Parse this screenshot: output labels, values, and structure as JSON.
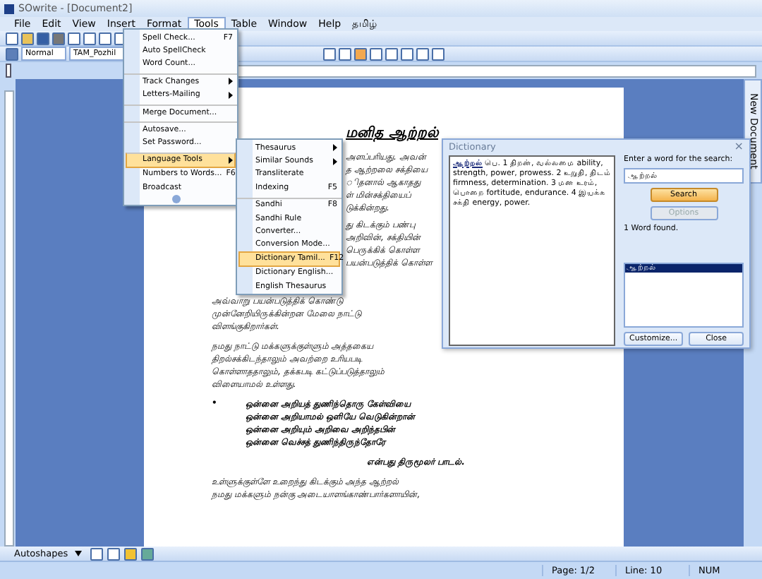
{
  "window": {
    "title": "SOwrite - [Document2]"
  },
  "menu_bar": [
    {
      "label": "File",
      "selected": false
    },
    {
      "label": "Edit",
      "selected": false
    },
    {
      "label": "View",
      "selected": false
    },
    {
      "label": "Insert",
      "selected": false
    },
    {
      "label": "Format",
      "selected": false
    },
    {
      "label": "Tools",
      "selected": true
    },
    {
      "label": "Table",
      "selected": false
    },
    {
      "label": "Window",
      "selected": false
    },
    {
      "label": "Help",
      "selected": false
    },
    {
      "label": "தமிழ்",
      "selected": false
    }
  ],
  "format_toolbar": {
    "style": "Normal",
    "font": "TAM_Pozhil"
  },
  "tools_menu": [
    {
      "label": "Spell Check...",
      "shortcut": "F7",
      "selected": false
    },
    {
      "label": "Auto SpellCheck",
      "selected": false
    },
    {
      "label": "Word Count...",
      "selected": false
    },
    {
      "label": "Track Changes",
      "submenu": true,
      "selected": false,
      "separator_before": true
    },
    {
      "label": "Letters-Mailing",
      "submenu": true,
      "selected": false
    },
    {
      "label": "Merge Document...",
      "selected": false,
      "separator_before": true
    },
    {
      "label": "Autosave...",
      "selected": false,
      "separator_before": true
    },
    {
      "label": "Set Password...",
      "selected": false
    },
    {
      "label": "Language Tools",
      "submenu": true,
      "selected": true,
      "separator_before": true
    },
    {
      "label": "Numbers to Words...",
      "shortcut": "F6",
      "selected": false
    },
    {
      "label": "Broadcast",
      "selected": false
    }
  ],
  "language_submenu": [
    {
      "label": "Thesaurus",
      "submenu": true,
      "selected": false
    },
    {
      "label": "Similar Sounds",
      "submenu": true,
      "selected": false
    },
    {
      "label": "Transliterate",
      "selected": false
    },
    {
      "label": "Indexing",
      "shortcut": "F5",
      "selected": false
    },
    {
      "label": "Sandhi",
      "shortcut": "F8",
      "selected": false,
      "separator_before": true
    },
    {
      "label": "Sandhi Rule",
      "selected": false
    },
    {
      "label": "Converter...",
      "selected": false
    },
    {
      "label": "Conversion Mode...",
      "selected": false
    },
    {
      "label": "Dictionary Tamil...",
      "shortcut": "F12",
      "selected": true
    },
    {
      "label": "Dictionary English...",
      "selected": false
    },
    {
      "label": "English Thesaurus",
      "selected": false
    }
  ],
  "document": [
    {
      "kind": "title",
      "lines": [
        "மனித ஆற்றல்"
      ]
    },
    {
      "kind": "partial",
      "lines": [
        "அளப்பரியது. அவன்",
        "த ஆற்றலை சக்தியை",
        "ிதனால் ஆகாதது",
        "ள் மின்சக்தியைப்",
        "டுக்கின்றது."
      ]
    },
    {
      "kind": "partial",
      "lines": [
        "து கிடக்கும் பண்பு",
        "அறிவின், சக்தியின்",
        "பெருக்கிக் கொள்ள",
        "பயன்படுத்திக் கொள்ள"
      ]
    },
    {
      "kind": "para",
      "lines": [
        "அவ்வாறு பயன்படுத்திக் கொண்டு",
        "முன்னேறியிருக்கின்றன மேலை நாட்டு",
        "விளங்குகிறார்கள்."
      ]
    },
    {
      "kind": "para",
      "lines": [
        "நமது நாட்டு மக்களுக்குள்ளும் அத்தகைய",
        "திறல்சக்கிடந்தாலும் அவற்றை உரியபடி",
        "கொள்ளாததாலும், தக்கபடி கட்டுப்படுத்தாலும்",
        "விளையாமல் உள்ளது."
      ]
    },
    {
      "kind": "poem",
      "marker": "•",
      "lines": [
        "ஒன்னை அறியத் துணிந்தொரு கேள்வியை",
        "ஒன்னை அறியாமல் ஒளியே வெடுகின்றான்",
        "ஒன்னை அறியும் அறிவை அறிந்தபின்",
        "ஒன்னை வெச்சத் துணிந்திருந்தோரே"
      ]
    },
    {
      "kind": "signature",
      "lines": [
        "என்பது திருமூலர் பாடல்."
      ]
    },
    {
      "kind": "para",
      "lines": [
        "உள்ளுக்குள்ளே உறைந்து கிடக்கும் அந்த ஆற்றல்",
        "நமது மக்களும் நன்கு அடையாளங்காண்பார்களாயின்,"
      ]
    }
  ],
  "dictionary": {
    "title": "Dictionary",
    "close": "×",
    "headword": "ஆற்றல்",
    "meaning": "பெ. 1 திறன், வல்லமை ability, strength, power, prowess. 2 உறுதி, திடம் firmness, determination. 3 மன உரம், பொறை fortitude, endurance. 4 இயக்க சக்தி energy, power.",
    "prompt": "Enter a word for the search:",
    "search_value": "ஆற்றல்",
    "search_button": "Search",
    "options_button": {
      "label": "Options",
      "disabled": true
    },
    "found": "1 Word found.",
    "results": [
      {
        "label": "ஆற்றல்",
        "selected": true
      }
    ],
    "customize_button": "Customize...",
    "close_button": "Close"
  },
  "side_panel": {
    "label": "New Document"
  },
  "drawing_toolbar": {
    "autoshapes": "Autoshapes"
  },
  "status_bar": [
    "Page: 1/2",
    "Line: 10",
    "NUM"
  ]
}
